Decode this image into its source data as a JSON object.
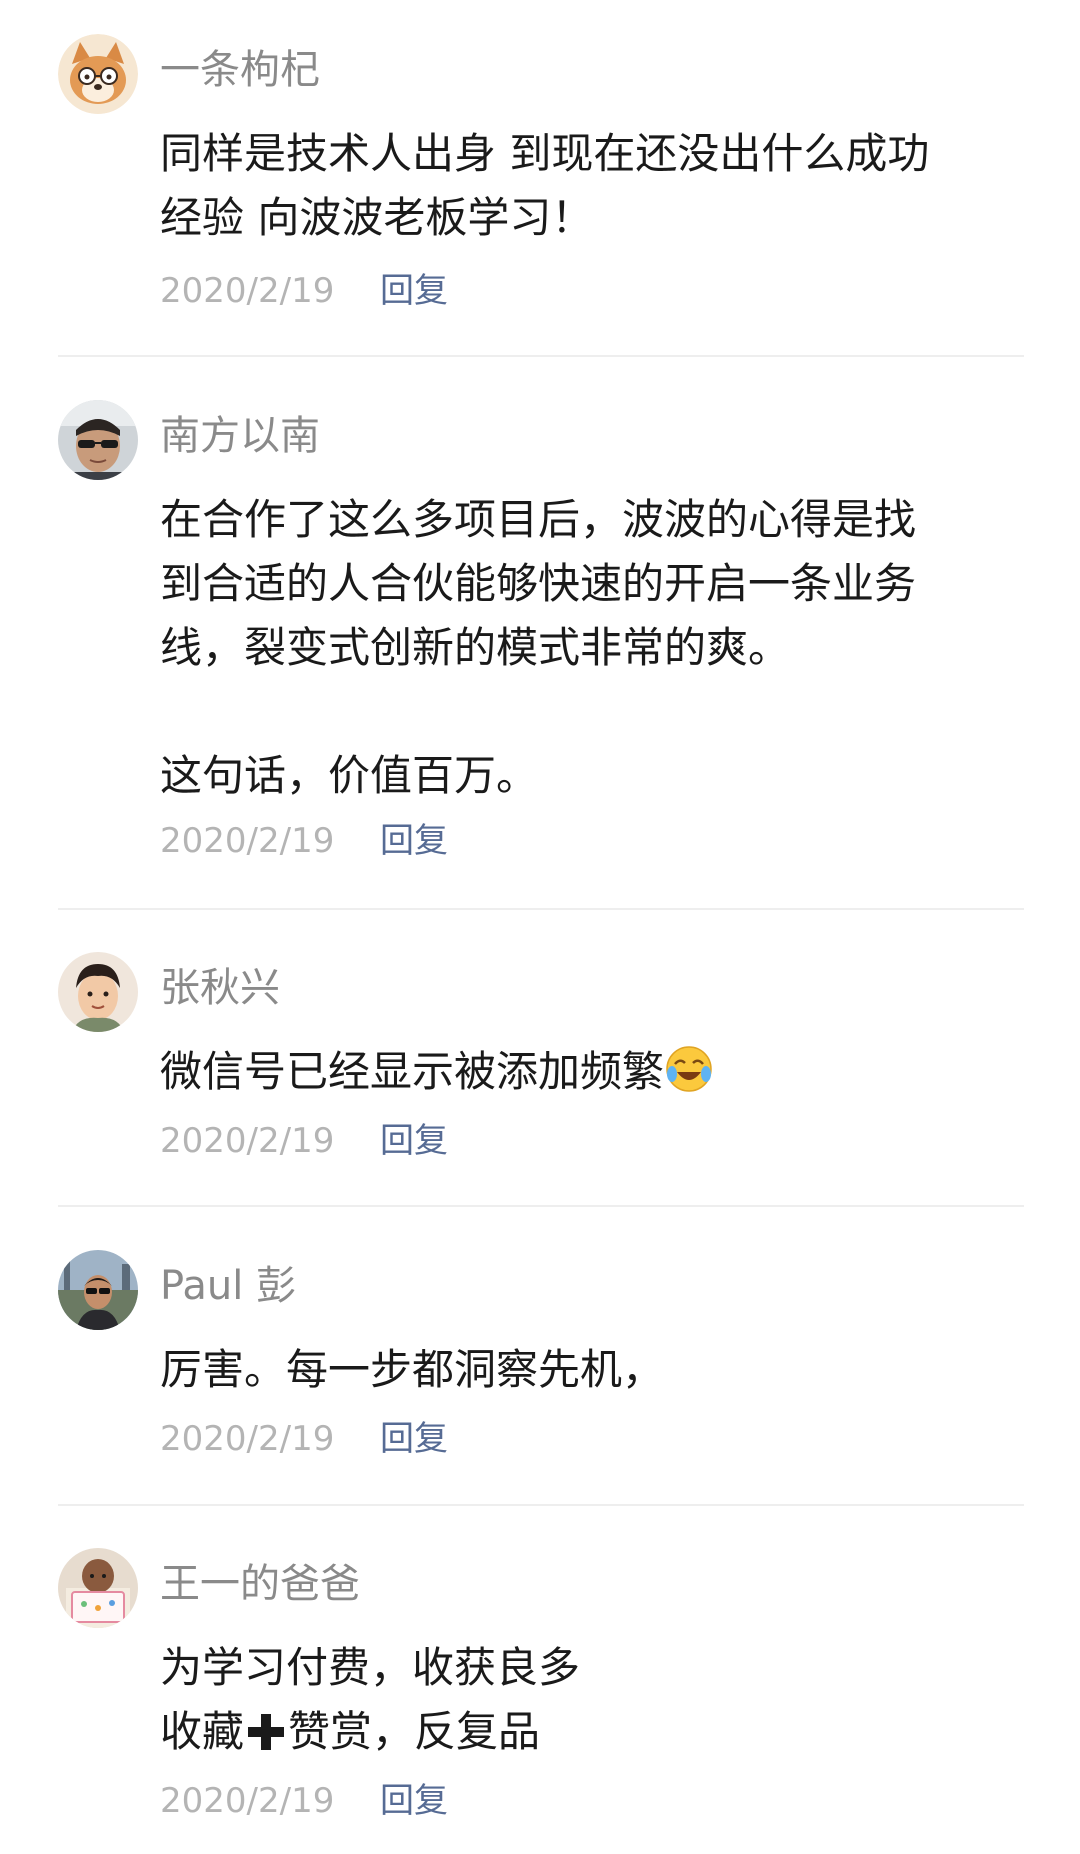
{
  "comments": [
    {
      "avatar": "shiba-dog-with-glasses-avatar",
      "nickname": "一条枸杞",
      "content": "同样是技术人出身 到现在还没出什么成功\n经验 向波波老板学习！",
      "date": "2020/2/19",
      "reply_label": "回复"
    },
    {
      "avatar": "man-with-sunglasses-avatar",
      "nickname": "南方以南",
      "content": "在合作了这么多项目后，波波的心得是找\n到合适的人合伙能够快速的开启一条业务\n线，裂变式创新的模式非常的爽。\n\n这句话，价值百万。",
      "date": "2020/2/19",
      "reply_label": "回复"
    },
    {
      "avatar": "cartoon-man-avatar",
      "nickname": "张秋兴",
      "content_text": "微信号已经显示被添加频繁",
      "content_emoji": "crying-laughing-emoji",
      "date": "2020/2/19",
      "reply_label": "回复"
    },
    {
      "avatar": "man-with-sunglasses-outdoor-avatar",
      "nickname": "Paul 彭",
      "content": "厉害。每一步都洞察先机，",
      "date": "2020/2/19",
      "reply_label": "回复"
    },
    {
      "avatar": "baby-photo-avatar",
      "nickname": "王一的爸爸",
      "content_line1": "为学习付费，收获良多",
      "content_line2_a": "收藏",
      "content_line2_icon": "plus-icon",
      "content_line2_b": "赞赏，反复品",
      "date": "2020/2/19",
      "reply_label": "回复"
    }
  ]
}
